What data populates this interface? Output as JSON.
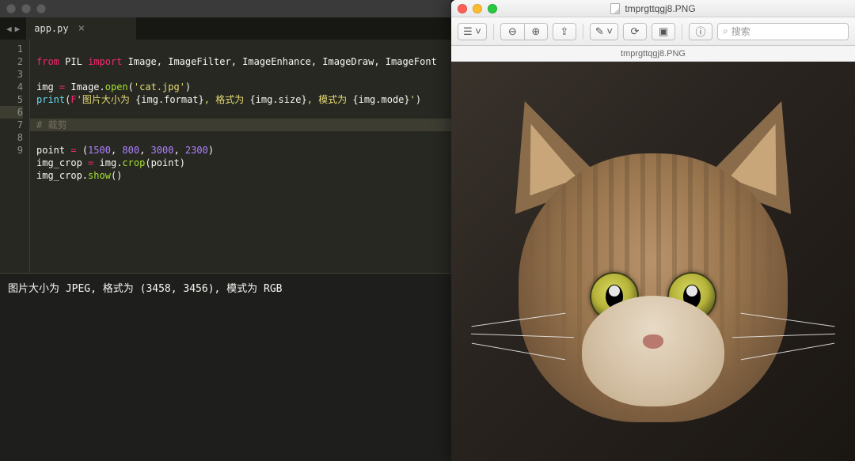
{
  "editor": {
    "tab_label": "app.py",
    "nav_back": "◀",
    "nav_fwd": "▶",
    "tab_close": "×",
    "gutter": [
      "1",
      "2",
      "3",
      "4",
      "5",
      "6",
      "7",
      "8",
      "9"
    ],
    "code": {
      "l1": {
        "kw_from": "from",
        "pkg": "PIL",
        "kw_import": "import",
        "names": "Image, ImageFilter, ImageEnhance, ImageDraw, ImageFont"
      },
      "l3": {
        "var": "img",
        "eq": "=",
        "obj": "Image",
        "dot": ".",
        "fn": "open",
        "arg": "'cat.jpg'"
      },
      "l4": {
        "fn": "print",
        "fprefix": "F",
        "str1": "'图片大小为 ",
        "exp1": "{img.format}",
        "str2": ", 格式为 ",
        "exp2": "{img.size}",
        "str3": ", 模式为 ",
        "exp3": "{img.mode}",
        "str4": "'"
      },
      "l6": {
        "comment": "# 裁剪"
      },
      "l7": {
        "var": "point",
        "eq": "=",
        "n1": "1500",
        "n2": "800",
        "n3": "3000",
        "n4": "2300"
      },
      "l8": {
        "var": "img_crop",
        "eq": "=",
        "obj": "img",
        "fn": "crop",
        "arg": "point"
      },
      "l9": {
        "obj": "img_crop",
        "fn": "show"
      }
    }
  },
  "console": {
    "output": "图片大小为 JPEG, 格式为 (3458, 3456), 模式为 RGB"
  },
  "preview": {
    "titlebar_filename": "tmprgttqgj8.PNG",
    "pathbar_filename": "tmprgttqgj8.PNG",
    "search_placeholder": "搜索",
    "icons": {
      "sidebar": "☰",
      "zoom_out": "⊖",
      "zoom_in": "⊕",
      "share": "⇪",
      "markup": "✎",
      "rotate": "⟳",
      "crop": "▣",
      "info": "ⓘ",
      "search": "⌕"
    }
  }
}
